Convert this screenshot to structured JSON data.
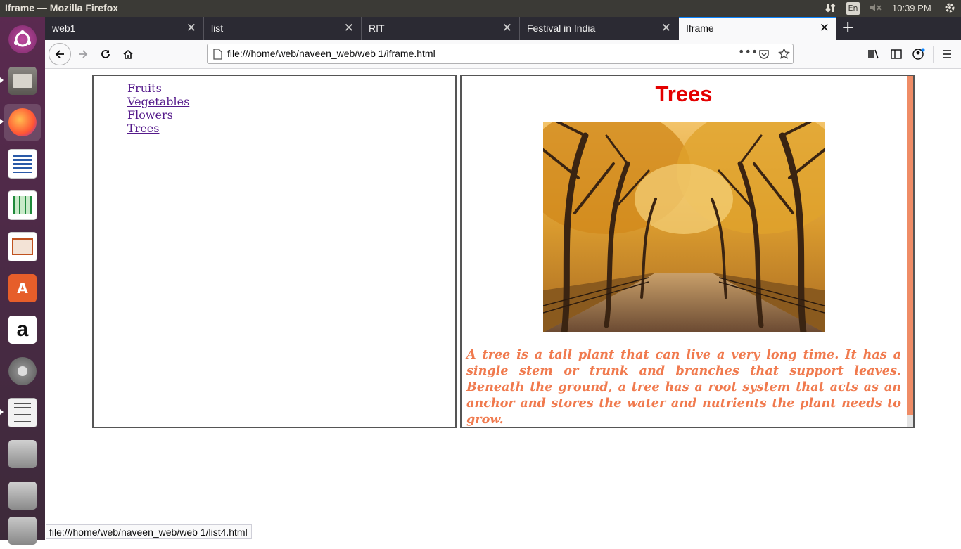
{
  "system": {
    "window_title": "Iframe — Mozilla Firefox",
    "keyboard_layout": "En",
    "clock": "10:39 PM"
  },
  "launcher": {
    "apps": [
      {
        "name": "ubuntu-dash-icon"
      },
      {
        "name": "files-icon"
      },
      {
        "name": "firefox-icon"
      },
      {
        "name": "writer-icon"
      },
      {
        "name": "calc-icon"
      },
      {
        "name": "impress-icon"
      },
      {
        "name": "software-center-icon"
      },
      {
        "name": "amazon-icon",
        "glyph": "a"
      },
      {
        "name": "system-settings-icon"
      },
      {
        "name": "text-editor-icon"
      },
      {
        "name": "disk-icon"
      },
      {
        "name": "disk-icon"
      },
      {
        "name": "trash-icon"
      }
    ]
  },
  "tabs": [
    {
      "label": "web1"
    },
    {
      "label": "list"
    },
    {
      "label": "RIT"
    },
    {
      "label": "Festival in India"
    },
    {
      "label": "Iframe"
    }
  ],
  "nav": {
    "url": "file:///home/web/naveen_web/web 1/iframe.html"
  },
  "left_frame": {
    "links": [
      "Fruits",
      "Vegetables",
      "Flowers",
      "Trees"
    ]
  },
  "right_frame": {
    "heading": "Trees",
    "paragraph": "A tree is a tall plant that can live a very long time. It has a single stem or trunk and branches that support leaves. Beneath the ground, a tree has a root system that acts as an anchor and stores the water and nutrients the plant needs to grow."
  },
  "status_bar": {
    "link_url": "file:///home/web/naveen_web/web 1/list4.html"
  },
  "colors": {
    "heading": "#e40000",
    "paragraph": "#f07a4e",
    "link": "#551a8b",
    "active_tab_accent": "#0a84ff"
  }
}
